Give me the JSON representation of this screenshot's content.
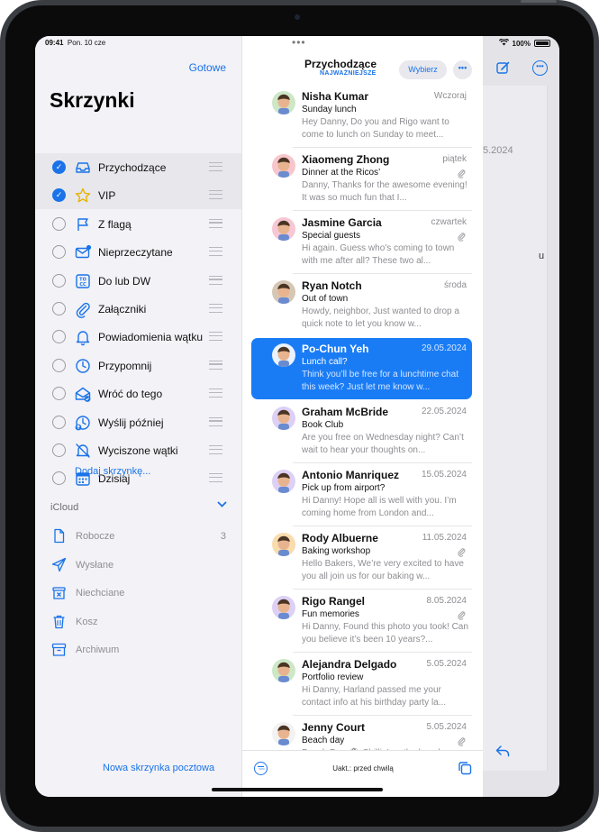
{
  "status": {
    "time": "09:41",
    "date": "Pon. 10 cze",
    "wifi": "wifi-icon",
    "battery": "100%"
  },
  "sidebar": {
    "done": "Gotowe",
    "title": "Skrzynki",
    "mailboxes": [
      {
        "label": "Przychodzące",
        "icon": "inbox-icon",
        "checked": true,
        "selected": true
      },
      {
        "label": "VIP",
        "icon": "star-icon",
        "checked": true,
        "selected": true
      },
      {
        "label": "Z flagą",
        "icon": "flag-icon",
        "checked": false
      },
      {
        "label": "Nieprzeczytane",
        "icon": "unread-envelope-icon",
        "checked": false
      },
      {
        "label": "Do lub DW",
        "icon": "to-cc-icon",
        "checked": false
      },
      {
        "label": "Załączniki",
        "icon": "paperclip-icon",
        "checked": false
      },
      {
        "label": "Powiadomienia wątku",
        "icon": "bell-icon",
        "checked": false
      },
      {
        "label": "Przypomnij",
        "icon": "clock-icon",
        "checked": false
      },
      {
        "label": "Wróć do tego",
        "icon": "follow-up-envelope-icon",
        "checked": false
      },
      {
        "label": "Wyślij później",
        "icon": "send-later-icon",
        "checked": false
      },
      {
        "label": "Wyciszone wątki",
        "icon": "muted-bell-icon",
        "checked": false
      },
      {
        "label": "Dzisiaj",
        "icon": "calendar-icon",
        "checked": false
      }
    ],
    "add_mailbox": "Dodaj skrzynkę...",
    "icloud": {
      "label": "iCloud",
      "items": [
        {
          "label": "Robocze",
          "icon": "draft-document-icon",
          "count": "3"
        },
        {
          "label": "Wysłane",
          "icon": "paper-plane-icon",
          "count": ""
        },
        {
          "label": "Niechciane",
          "icon": "junk-box-icon",
          "count": ""
        },
        {
          "label": "Kosz",
          "icon": "trash-icon",
          "count": ""
        },
        {
          "label": "Archiwum",
          "icon": "archive-box-icon",
          "count": ""
        }
      ]
    },
    "new_mailbox": "Nowa skrzynka pocztowa"
  },
  "list": {
    "title": "Przychodzące",
    "subtitle": "NAJWAŻNIEJSZE",
    "select": "Wybierz",
    "updated": "Uakt.: przed chwilą",
    "messages": [
      {
        "sender": "Nisha Kumar",
        "date": "Wczoraj",
        "subject": "Sunday lunch",
        "preview": "Hey Danny, Do you and Rigo want to come to lunch on Sunday to meet...",
        "attachment": false,
        "avatar": "#cde7c7"
      },
      {
        "sender": "Xiaomeng Zhong",
        "date": "piątek",
        "subject": "Dinner at the Ricos’",
        "preview": "Danny, Thanks for the awesome evening! It was so much fun that I...",
        "attachment": true,
        "avatar": "#f7c6cc"
      },
      {
        "sender": "Jasmine Garcia",
        "date": "czwartek",
        "subject": "Special guests",
        "preview": "Hi again. Guess who’s coming to town with me after all? These two al...",
        "attachment": true,
        "avatar": "#f6c7d4"
      },
      {
        "sender": "Ryan Notch",
        "date": "środa",
        "subject": "Out of town",
        "preview": "Howdy, neighbor, Just wanted to drop a quick note to let you know w...",
        "attachment": false,
        "avatar": "#d6c6b4"
      },
      {
        "sender": "Po-Chun Yeh",
        "date": "29.05.2024",
        "subject": "Lunch call?",
        "preview": "Think you’ll be free for a lunchtime chat this week? Just let me know w...",
        "attachment": false,
        "avatar": "#cfe6ff",
        "active": true
      },
      {
        "sender": "Graham McBride",
        "date": "22.05.2024",
        "subject": "Book Club",
        "preview": "Are you free on Wednesday night? Can’t wait to hear your thoughts on...",
        "attachment": false,
        "avatar": "#ddd0f5"
      },
      {
        "sender": "Antonio Manriquez",
        "date": "15.05.2024",
        "subject": "Pick up from airport?",
        "preview": "Hi Danny! Hope all is well with you. I’m coming home from London and...",
        "attachment": false,
        "avatar": "#ddd0f5"
      },
      {
        "sender": "Rody Albuerne",
        "date": "11.05.2024",
        "subject": "Baking workshop",
        "preview": "Hello Bakers, We’re very excited to have you all join us for our baking w...",
        "attachment": true,
        "avatar": "#f9dcae"
      },
      {
        "sender": "Rigo Rangel",
        "date": "8.05.2024",
        "subject": "Fun memories",
        "preview": "Hi Danny, Found this photo you took! Can you believe it’s been 10 years?...",
        "attachment": true,
        "avatar": "#ddd0f5"
      },
      {
        "sender": "Alejandra Delgado",
        "date": "5.05.2024",
        "subject": "Portfolio review",
        "preview": "Hi Danny, Harland passed me your contact info at his birthday party la...",
        "attachment": false,
        "avatar": "#cde7c7"
      },
      {
        "sender": "Jenny Court",
        "date": "5.05.2024",
        "subject": "Beach day",
        "preview": "Beach Day 🏖 Chillin' on the beach...",
        "attachment": true,
        "avatar": "#f2f2f2"
      }
    ]
  },
  "detail": {
    "date": "5.2024",
    "snippet": "u"
  }
}
